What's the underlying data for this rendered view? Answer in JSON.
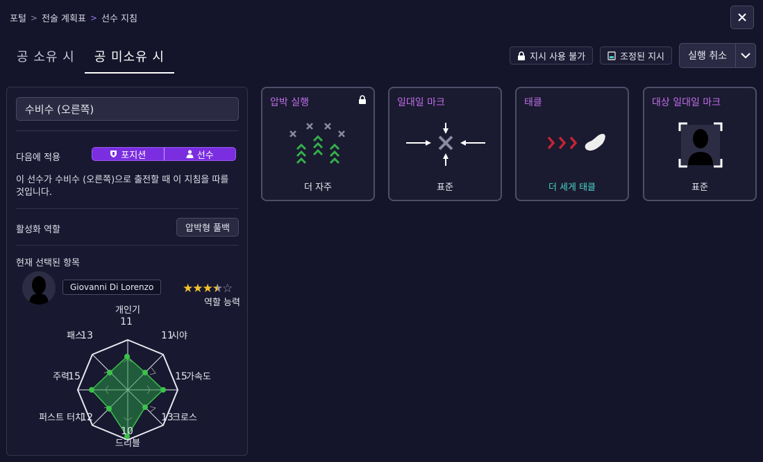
{
  "breadcrumb": {
    "item1": "포털",
    "item2": "전술 계획표",
    "item3": "선수 지침"
  },
  "tabs": [
    {
      "label": "공 소유 시"
    },
    {
      "label": "공 미소유 시"
    }
  ],
  "toolbar": {
    "unavailable": "지시 사용 불가",
    "adjusted": "조정된 지시",
    "cancel": "실행 취소"
  },
  "panel": {
    "position": "수비수 (오른쪽)",
    "apply_label": "다음에 적용",
    "apply_options": [
      "포지션",
      "선수"
    ],
    "description": "이 선수가 수비수 (오른쪽)으로 출전할 때 이 지침을 따를 것입니다.",
    "active_role_label": "활성화 역할",
    "active_role_value": "압박형 풀백",
    "current_selection_label": "현재 선택된 항목",
    "player_name": "Giovanni Di Lorenzo",
    "role_ability_label": "역할 능력",
    "role_ability_stars": 3.5
  },
  "radar": {
    "attributes": [
      {
        "label": "개인기",
        "value": "11"
      },
      {
        "label": "시야",
        "value": "11"
      },
      {
        "label": "가속도",
        "value": "15"
      },
      {
        "label": "크로스",
        "value": "13"
      },
      {
        "label": "드리블",
        "value": "10"
      },
      {
        "label": "퍼스트 터치",
        "value": "12"
      },
      {
        "label": "주력",
        "value": "15"
      },
      {
        "label": "패스",
        "value": "13"
      }
    ]
  },
  "cards": [
    {
      "title": "압박 실행",
      "value": "더 자주",
      "locked": true
    },
    {
      "title": "일대일 마크",
      "value": "표준"
    },
    {
      "title": "태클",
      "value": "더 세게 태클"
    },
    {
      "title": "대상 일대일 마크",
      "value": "표준"
    }
  ],
  "colors": {
    "accent_purple": "#7a2ee0",
    "title_purple": "#c070e8",
    "teal": "#4ad4c8",
    "green": "#3cc24a",
    "red": "#d8283c",
    "star": "#f2c230"
  }
}
